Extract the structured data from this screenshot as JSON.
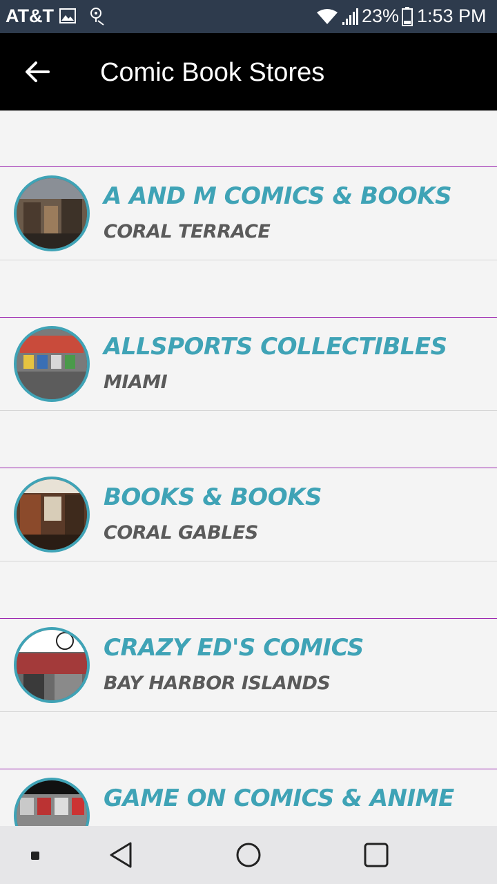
{
  "status_bar": {
    "carrier": "AT&T",
    "battery": "23%",
    "time": "1:53 PM"
  },
  "app_bar": {
    "title": "Comic Book Stores"
  },
  "stores": [
    {
      "name": "A and M Comics & Books",
      "city": "Coral Terrace"
    },
    {
      "name": "Allsports Collectibles",
      "city": "Miami"
    },
    {
      "name": "Books & Books",
      "city": "Coral Gables"
    },
    {
      "name": "Crazy Ed's Comics",
      "city": "Bay Harbor Islands"
    },
    {
      "name": "Game On Comics & Anime",
      "city": ""
    }
  ],
  "colors": {
    "accent": "#3fa3b6",
    "divider": "#9c27b0",
    "app_bar": "#000000",
    "status_bar": "#2e3b4d"
  }
}
